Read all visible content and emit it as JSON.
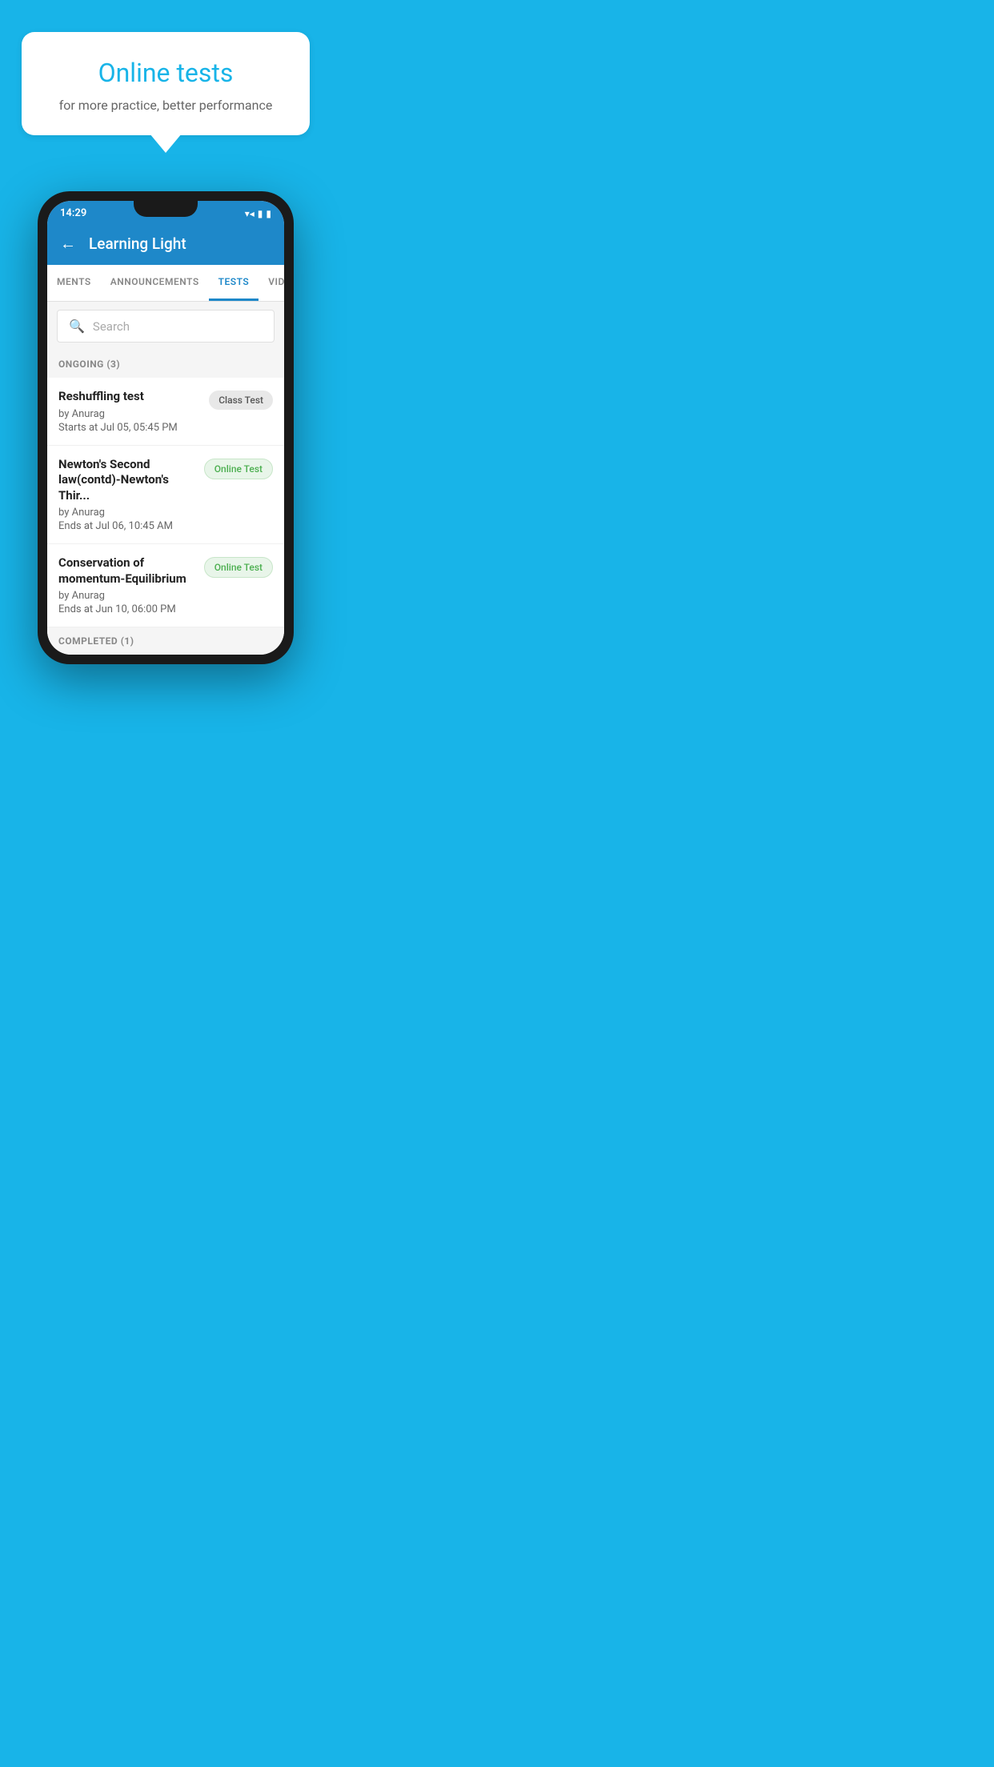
{
  "background_color": "#18b4e8",
  "bubble": {
    "title": "Online tests",
    "subtitle": "for more practice, better performance"
  },
  "status_bar": {
    "time": "14:29",
    "wifi": "▼▲",
    "battery": "▮"
  },
  "app_header": {
    "title": "Learning Light",
    "back_label": "←"
  },
  "tabs": [
    {
      "label": "MENTS",
      "active": false
    },
    {
      "label": "ANNOUNCEMENTS",
      "active": false
    },
    {
      "label": "TESTS",
      "active": true
    },
    {
      "label": "VIDEOS",
      "active": false
    }
  ],
  "search": {
    "placeholder": "Search"
  },
  "ongoing_section": {
    "label": "ONGOING (3)"
  },
  "tests": [
    {
      "name": "Reshuffling test",
      "author": "by Anurag",
      "time_label": "Starts at",
      "time": "Jul 05, 05:45 PM",
      "badge": "Class Test",
      "badge_type": "class"
    },
    {
      "name": "Newton's Second law(contd)-Newton's Thir...",
      "author": "by Anurag",
      "time_label": "Ends at",
      "time": "Jul 06, 10:45 AM",
      "badge": "Online Test",
      "badge_type": "online"
    },
    {
      "name": "Conservation of momentum-Equilibrium",
      "author": "by Anurag",
      "time_label": "Ends at",
      "time": "Jun 10, 06:00 PM",
      "badge": "Online Test",
      "badge_type": "online"
    }
  ],
  "completed_section": {
    "label": "COMPLETED (1)"
  }
}
